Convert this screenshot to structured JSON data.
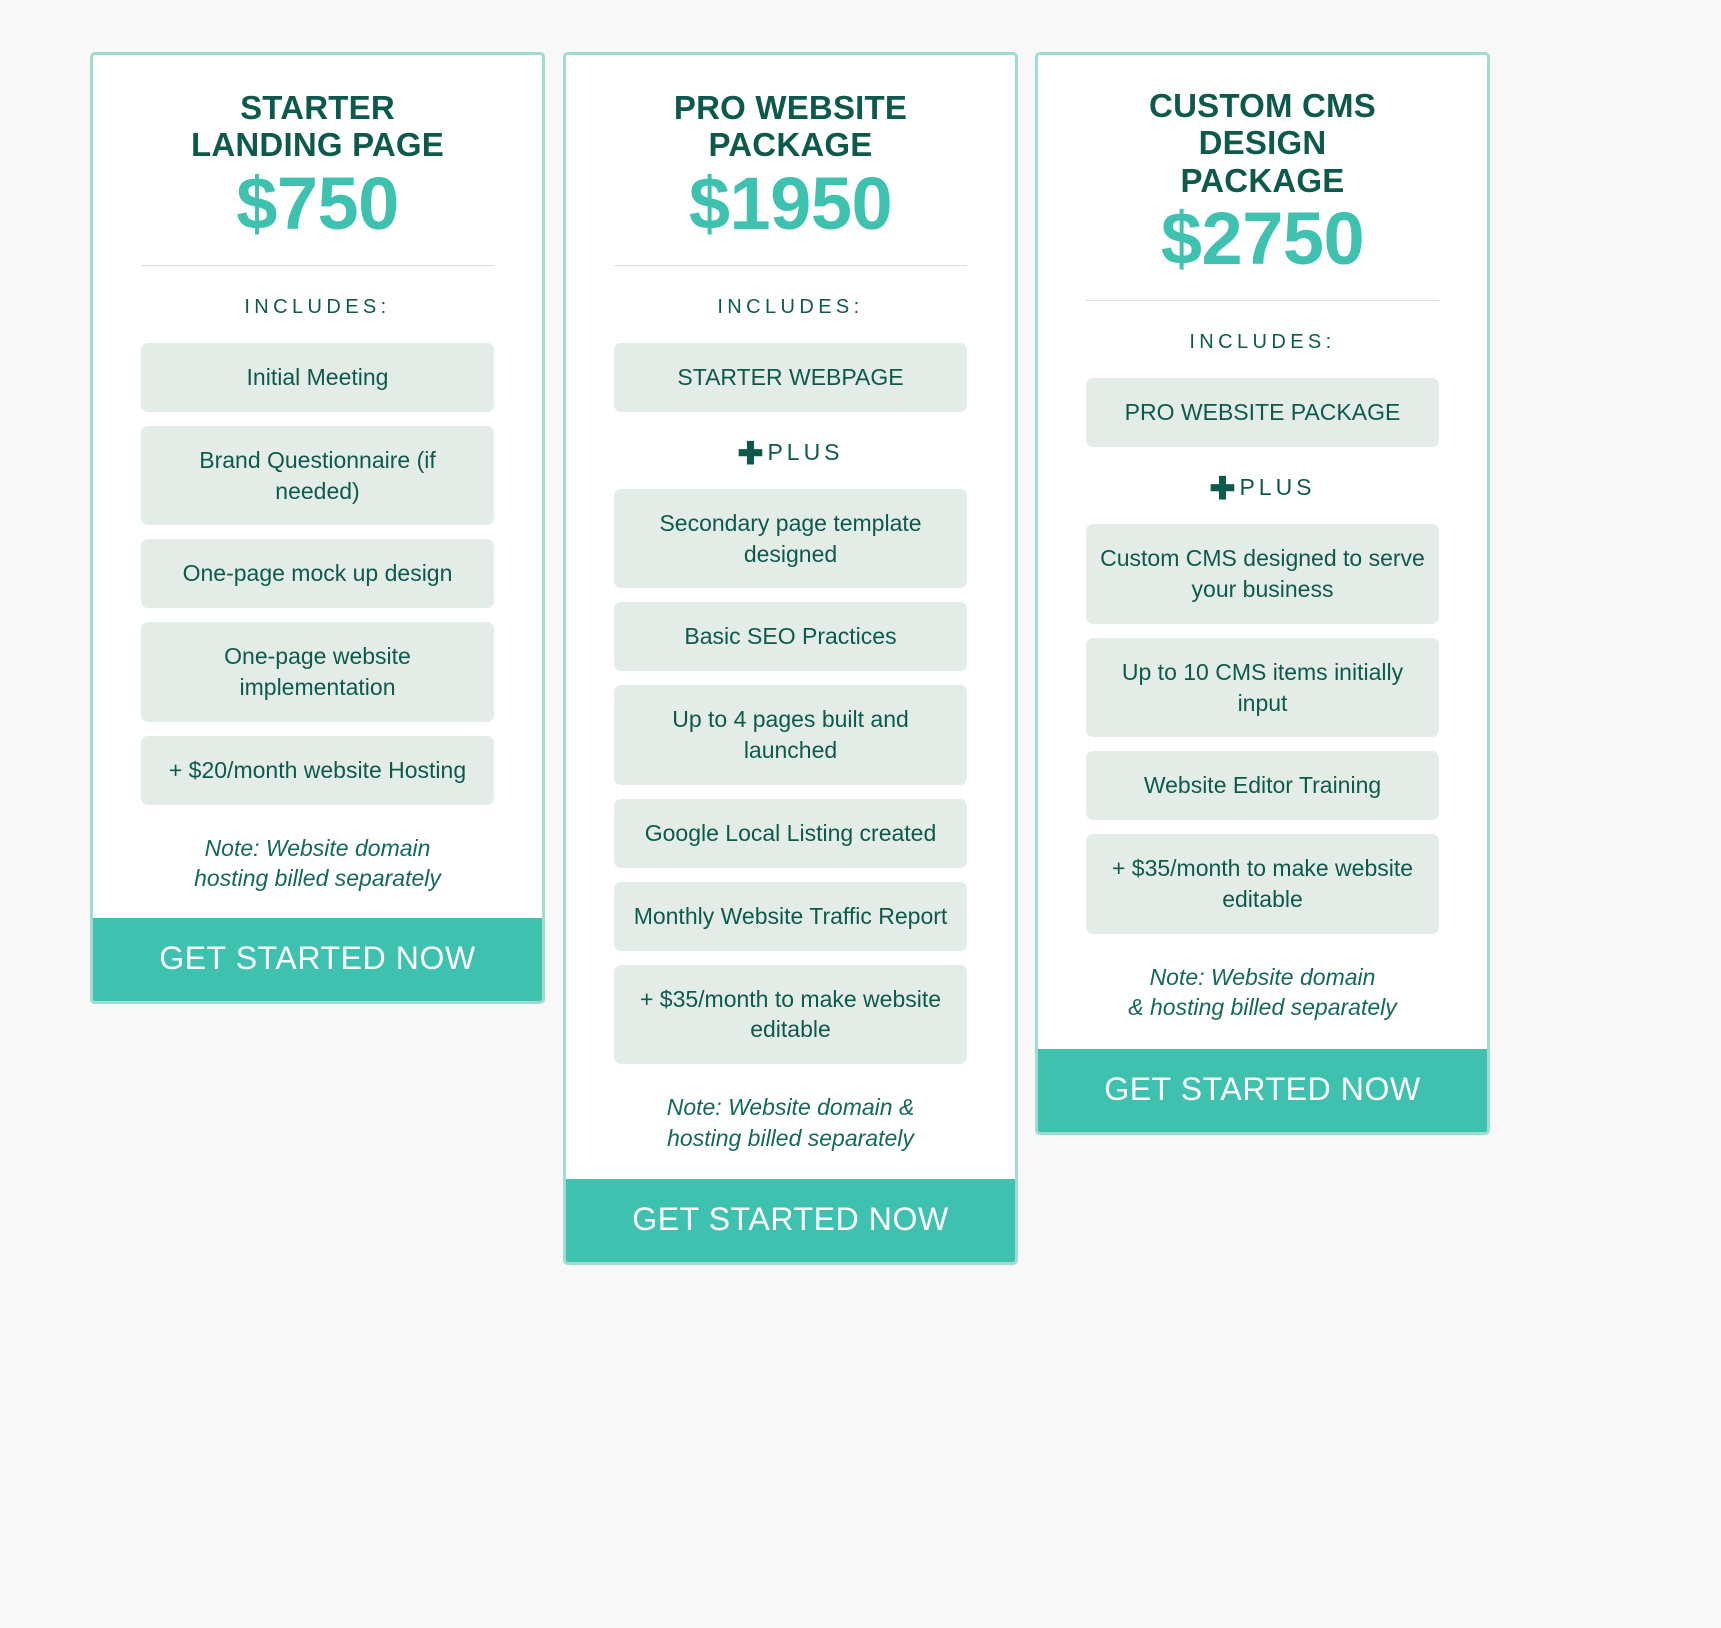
{
  "theme": {
    "page_background": "#f7f8f7",
    "card_border": "#9fdbd0",
    "title_color": "#0d5a4c",
    "price_color": "#3ec1af",
    "pill_background": "#e4ece8",
    "cta_background": "#3ec1af",
    "cta_text_color": "#ffffff"
  },
  "plans": [
    {
      "title": "STARTER\nLANDING PAGE",
      "price": "$750",
      "includes_label": "INCLUDES:",
      "features": [
        "Initial Meeting",
        "Brand Questionnaire (if needed)",
        "One-page mock up design",
        "One-page website implementation",
        "+ $20/month website Hosting"
      ],
      "note": "Note: Website domain\nhosting billed separately",
      "cta_label": "GET STARTED NOW"
    },
    {
      "title": "PRO WEBSITE\nPACKAGE",
      "price": "$1950",
      "includes_label": "INCLUDES:",
      "base_feature": "STARTER WEBPAGE",
      "plus_glyph": "plus-icon",
      "plus_symbol": "✚",
      "plus_label": "PLUS",
      "features": [
        "Secondary page template designed",
        "Basic SEO Practices",
        "Up to 4 pages built and launched",
        "Google Local Listing created",
        "Monthly Website Traffic Report",
        "+ $35/month to make website editable"
      ],
      "note": "Note: Website domain &\nhosting billed separately",
      "cta_label": "GET STARTED NOW"
    },
    {
      "title": "CUSTOM CMS DESIGN\nPACKAGE",
      "price": "$2750",
      "includes_label": "INCLUDES:",
      "base_feature": "PRO WEBSITE PACKAGE",
      "plus_glyph": "plus-icon",
      "plus_symbol": "✚",
      "plus_label": "PLUS",
      "features": [
        "Custom CMS designed to serve your business",
        "Up to 10 CMS items initially input",
        "Website Editor Training",
        "+ $35/month to make website editable"
      ],
      "note": "Note: Website domain\n& hosting billed separately",
      "cta_label": "GET STARTED NOW"
    }
  ]
}
